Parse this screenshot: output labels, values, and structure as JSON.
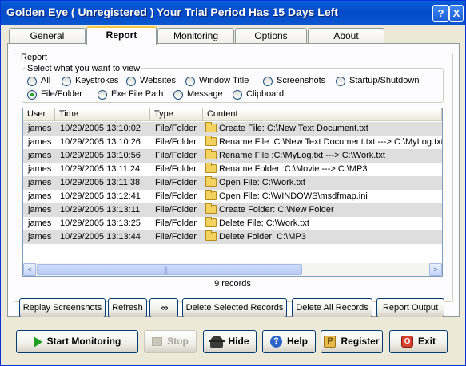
{
  "window": {
    "title": "Golden Eye ( Unregistered )  Your Trial Period Has 15 Days Left",
    "help_glyph": "?",
    "close_glyph": "X"
  },
  "tabs": [
    "General",
    "Report",
    "Monitoring",
    "Options",
    "About"
  ],
  "active_tab": "Report",
  "report": {
    "group_label": "Report",
    "select_label": "Select what you want to view",
    "filters_row1": [
      "All",
      "Keystrokes",
      "Websites",
      "Window Title",
      "Screenshots",
      "Startup/Shutdown"
    ],
    "filters_row2": [
      "File/Folder",
      "Exe File Path",
      "Message",
      "Clipboard"
    ],
    "selected_filter": "File/Folder",
    "columns": [
      "User",
      "Time",
      "Type",
      "Content"
    ],
    "rows": [
      [
        "james",
        "10/29/2005 13:10:02",
        "File/Folder",
        "Create File: C:\\New Text Document.txt"
      ],
      [
        "james",
        "10/29/2005 13:10:26",
        "File/Folder",
        "Rename File :C:\\New Text Document.txt ---> C:\\MyLog.txt"
      ],
      [
        "james",
        "10/29/2005 13:10:56",
        "File/Folder",
        "Rename File :C:\\MyLog.txt ---> C:\\Work.txt"
      ],
      [
        "james",
        "10/29/2005 13:11:24",
        "File/Folder",
        "Rename Folder :C:\\Movie ---> C:\\MP3"
      ],
      [
        "james",
        "10/29/2005 13:11:38",
        "File/Folder",
        "Open File: C:\\Work.txt"
      ],
      [
        "james",
        "10/29/2005 13:12:41",
        "File/Folder",
        "Open File: C:\\WINDOWS\\msdfmap.ini"
      ],
      [
        "james",
        "10/29/2005 13:13:11",
        "File/Folder",
        "Create Folder: C:\\New Folder"
      ],
      [
        "james",
        "10/29/2005 13:13:25",
        "File/Folder",
        "Delete File: C:\\Work.txt"
      ],
      [
        "james",
        "10/29/2005 13:13:44",
        "File/Folder",
        "Delete Folder: C:\\MP3"
      ]
    ],
    "record_count": "9 records",
    "scroll_left": "<",
    "scroll_right": ">"
  },
  "actions": {
    "replay": "Replay Screenshots",
    "refresh": "Refresh",
    "find_glyph": "∞",
    "delete_selected": "Delete Selected Records",
    "delete_all": "Delete All Records",
    "output": "Report Output"
  },
  "bottom": {
    "start": "Start Monitoring",
    "stop": "Stop",
    "hide": "Hide",
    "help": "Help",
    "help_glyph": "?",
    "register": "Register",
    "register_glyph": "P",
    "exit": "Exit",
    "exit_glyph": "O"
  },
  "colors": {
    "title_bar": "#0349c9",
    "window_bg": "#ece9d8",
    "row_alt": "#dedede",
    "radio_dot": "#21a121"
  },
  "icons": [
    "folder-icon",
    "play-icon",
    "stop-icon",
    "spy-icon",
    "help-icon",
    "key-icon",
    "exit-icon",
    "binoculars-icon"
  ]
}
